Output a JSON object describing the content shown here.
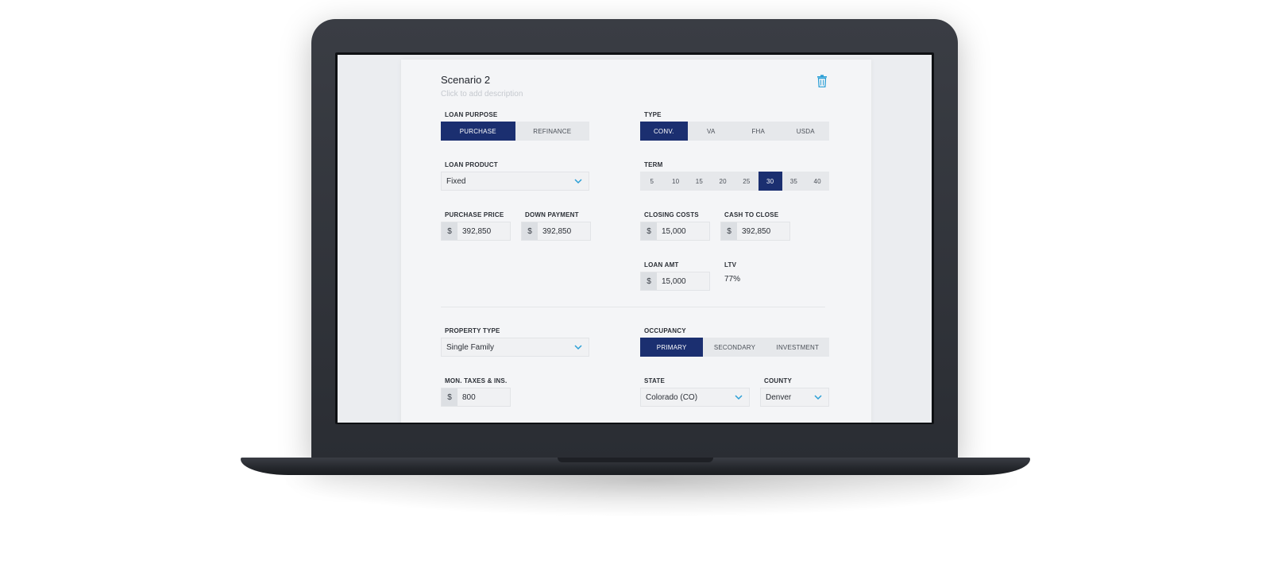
{
  "scenario": {
    "title": "Scenario 2",
    "description_placeholder": "Click to add description"
  },
  "loan_purpose": {
    "label": "LOAN PURPOSE",
    "options": [
      "PURCHASE",
      "REFINANCE"
    ],
    "selected": "PURCHASE"
  },
  "type": {
    "label": "TYPE",
    "options": [
      "CONV.",
      "VA",
      "FHA",
      "USDA"
    ],
    "selected": "CONV."
  },
  "loan_product": {
    "label": "LOAN PRODUCT",
    "value": "Fixed"
  },
  "term": {
    "label": "TERM",
    "options": [
      "5",
      "10",
      "15",
      "20",
      "25",
      "30",
      "35",
      "40"
    ],
    "selected": "30"
  },
  "purchase_price": {
    "label": "PURCHASE PRICE",
    "currency": "$",
    "value": "392,850"
  },
  "down_payment": {
    "label": "DOWN PAYMENT",
    "currency": "$",
    "value": "392,850"
  },
  "closing_costs": {
    "label": "CLOSING COSTS",
    "currency": "$",
    "value": "15,000"
  },
  "cash_to_close": {
    "label": "CASH TO CLOSE",
    "currency": "$",
    "value": "392,850"
  },
  "loan_amt": {
    "label": "LOAN AMT",
    "currency": "$",
    "value": "15,000"
  },
  "ltv": {
    "label": "LTV",
    "value": "77%"
  },
  "property_type": {
    "label": "PROPERTY TYPE",
    "value": "Single Family"
  },
  "occupancy": {
    "label": "OCCUPANCY",
    "options": [
      "PRIMARY",
      "SECONDARY",
      "INVESTMENT"
    ],
    "selected": "PRIMARY"
  },
  "taxes": {
    "label": "MON. TAXES & INS.",
    "currency": "$",
    "value": "800"
  },
  "state": {
    "label": "STATE",
    "value": "Colorado (CO)"
  },
  "county": {
    "label": "COUNTY",
    "value": "Denver"
  },
  "colors": {
    "accent": "#1b2f70",
    "chevron": "#2a9fd6",
    "trash": "#2a9fd6"
  },
  "icons": {
    "trash": "trash-icon",
    "chevron": "chevron-down-icon"
  }
}
